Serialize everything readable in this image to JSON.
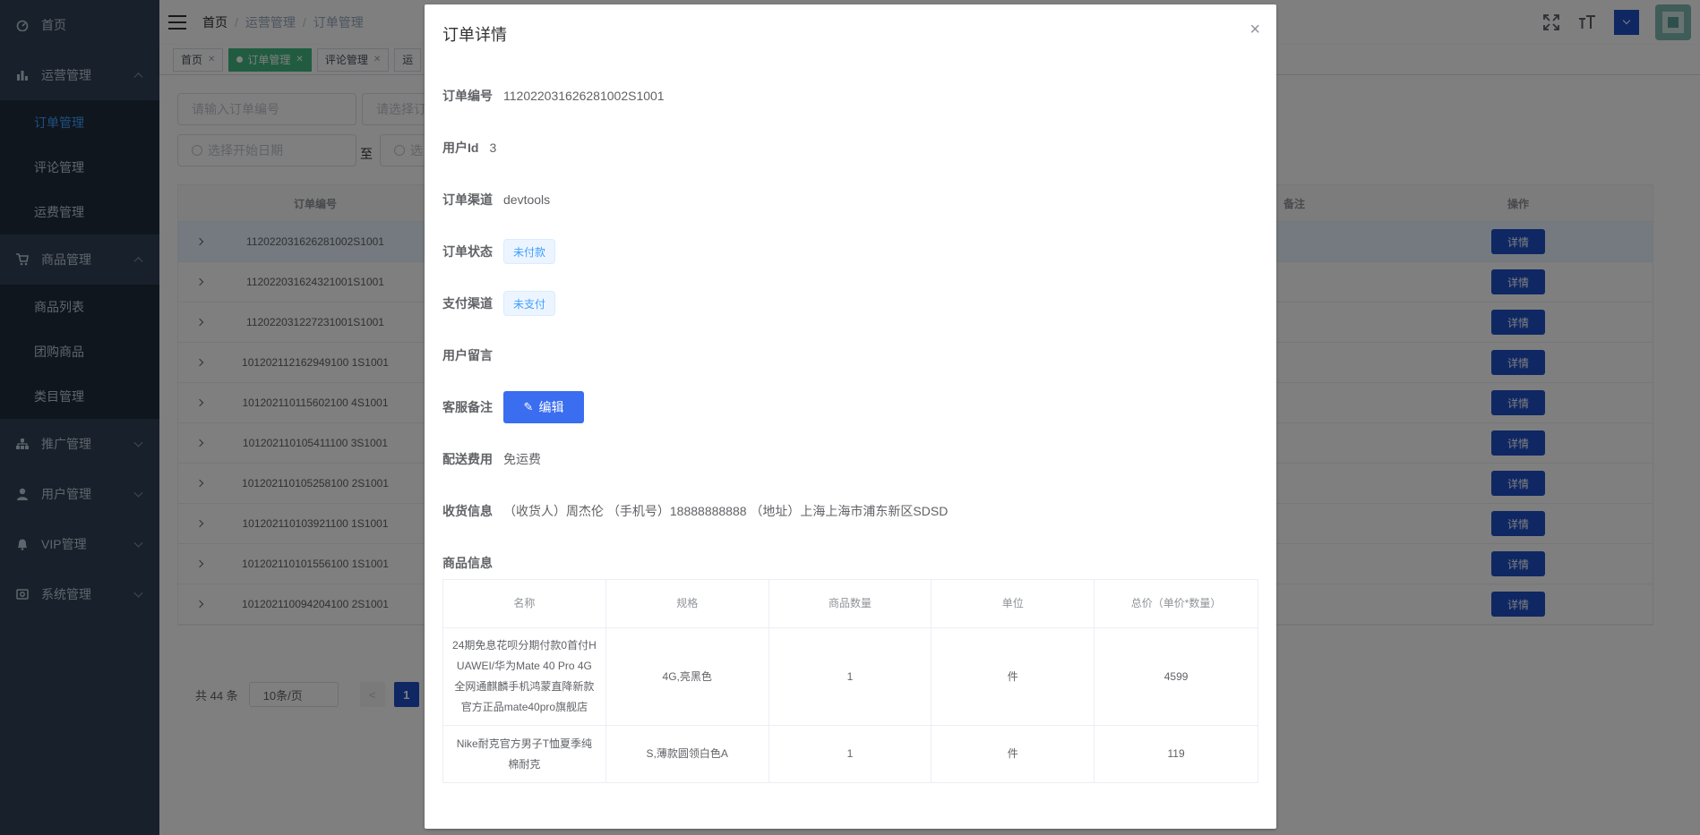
{
  "sidebar": {
    "items": [
      {
        "label": "首页"
      },
      {
        "label": "运营管理"
      },
      {
        "label": "商品管理"
      },
      {
        "label": "推广管理"
      },
      {
        "label": "用户管理"
      },
      {
        "label": "VIP管理"
      },
      {
        "label": "系统管理"
      }
    ],
    "ops_sub": [
      "订单管理",
      "评论管理",
      "运费管理"
    ],
    "goods_sub": [
      "商品列表",
      "团购商品",
      "类目管理"
    ]
  },
  "navbar": {
    "breadcrumb": [
      "首页",
      "运营管理",
      "订单管理"
    ]
  },
  "tags": [
    {
      "label": "首页"
    },
    {
      "label": "订单管理"
    },
    {
      "label": "评论管理"
    },
    {
      "label": "运"
    }
  ],
  "filters": {
    "order_no_placeholder": "请输入订单编号",
    "status_placeholder": "请选择订",
    "start_date_placeholder": "选择开始日期",
    "to": "至",
    "end_date_placeholder": "选"
  },
  "table": {
    "headers": {
      "order_no": "订单编号",
      "remark": "备注",
      "op": "操作"
    },
    "detail_label": "详情",
    "rows": [
      "112022031626281002S1001",
      "112022031624321001S1001",
      "112022031227231001S1001",
      "101202112162949100 1S1001",
      "101202110115602100 4S1001",
      "101202110105411100 3S1001",
      "101202110105258100 2S1001",
      "101202110103921100 1S1001",
      "101202110101556100 1S1001",
      "101202110094204100 2S1001"
    ]
  },
  "pager": {
    "total": "共 44 条",
    "size": "10条/页",
    "prev": "<",
    "current": "1"
  },
  "dialog": {
    "title": "订单详情",
    "close": "×",
    "fields": {
      "order_no_label": "订单编号",
      "order_no": "112022031626281002S1001",
      "user_id_label": "用户Id",
      "user_id": "3",
      "channel_label": "订单渠道",
      "channel": "devtools",
      "status_label": "订单状态",
      "status": "未付款",
      "pay_label": "支付渠道",
      "pay": "未支付",
      "message_label": "用户留言",
      "remark_label": "客服备注",
      "edit_button": "编辑",
      "shipping_label": "配送费用",
      "shipping": "免运费",
      "receiver_label": "收货信息",
      "receiver": "（收货人）周杰伦 （手机号）18888888888 （地址）上海上海市浦东新区SDSD",
      "goods_label": "商品信息"
    },
    "goods_table": {
      "headers": [
        "名称",
        "规格",
        "商品数量",
        "单位",
        "总价（单价*数量）"
      ],
      "rows": [
        {
          "name_lines": [
            "24期免息花呗分期付款0首付H",
            "UAWEI/华为Mate 40 Pro 4G",
            "全网通麒麟手机鸿蒙直降新款",
            "官方正品mate40pro旗舰店"
          ],
          "spec": "4G,亮黑色",
          "qty": "1",
          "unit": "件",
          "total": "4599"
        },
        {
          "name_lines": [
            "Nike耐克官方男子T恤夏季纯",
            "棉耐克"
          ],
          "spec": "S,薄款圆领白色A",
          "qty": "1",
          "unit": "件",
          "total": "119"
        }
      ]
    }
  },
  "colors": {
    "sidebar_bg": "#304156",
    "sidebar_sub_bg": "#1f2d3d",
    "active_text": "#409eff",
    "tag_active": "#42b983",
    "primary_button": "#1f4fc6",
    "edit_button": "#3a6df0"
  }
}
